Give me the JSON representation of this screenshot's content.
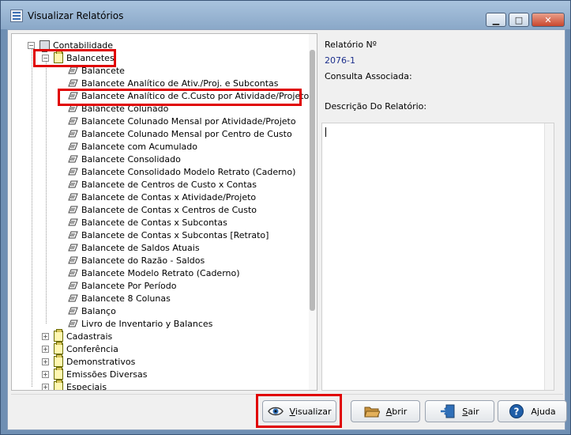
{
  "window": {
    "title": "Visualizar Relatórios",
    "controls": {
      "minimize": "▁",
      "maximize": "□",
      "close": "✕"
    }
  },
  "tree": {
    "root": "Contabilidade",
    "group_open": "Balancetes",
    "items": [
      "Balancete",
      "Balancete Analítico de Ativ./Proj. e Subcontas",
      "Balancete Analítico de C.Custo por Atividade/Projeto",
      "Balancete Colunado",
      "Balancete Colunado Mensal por Atividade/Projeto",
      "Balancete Colunado Mensal por Centro de Custo",
      "Balancete com Acumulado",
      "Balancete Consolidado",
      "Balancete Consolidado Modelo Retrato (Caderno)",
      "Balancete de Centros de Custo x Contas",
      "Balancete de Contas x Atividade/Projeto",
      "Balancete de Contas x Centros de Custo",
      "Balancete de Contas x Subcontas",
      "Balancete de Contas x Subcontas [Retrato]",
      "Balancete de Saldos Atuais",
      "Balancete do Razão - Saldos",
      "Balancete Modelo Retrato (Caderno)",
      "Balancete Por Período",
      "Balancete 8 Colunas",
      "Balanço",
      "Livro de Inventario y Balances"
    ],
    "collapsed_groups": [
      "Cadastrais",
      "Conferência",
      "Demonstrativos",
      "Emissões Diversas",
      "Especiais"
    ],
    "selected_item": "Balancete Analítico de C.Custo por Atividade/Projeto"
  },
  "details": {
    "report_number_label": "Relatório Nº",
    "report_number_value": "2076-1",
    "associated_query_label": "Consulta Associada:",
    "description_label": "Descrição Do Relatório:",
    "description_value": ""
  },
  "buttons": {
    "visualizar": "Visualizar",
    "abrir": "Abrir",
    "sair": "Sair",
    "ajuda": "Ajuda"
  },
  "colors": {
    "highlight": "#e00000",
    "value_text": "#1c2f8c",
    "title_gradient_top": "#a9c3de"
  }
}
